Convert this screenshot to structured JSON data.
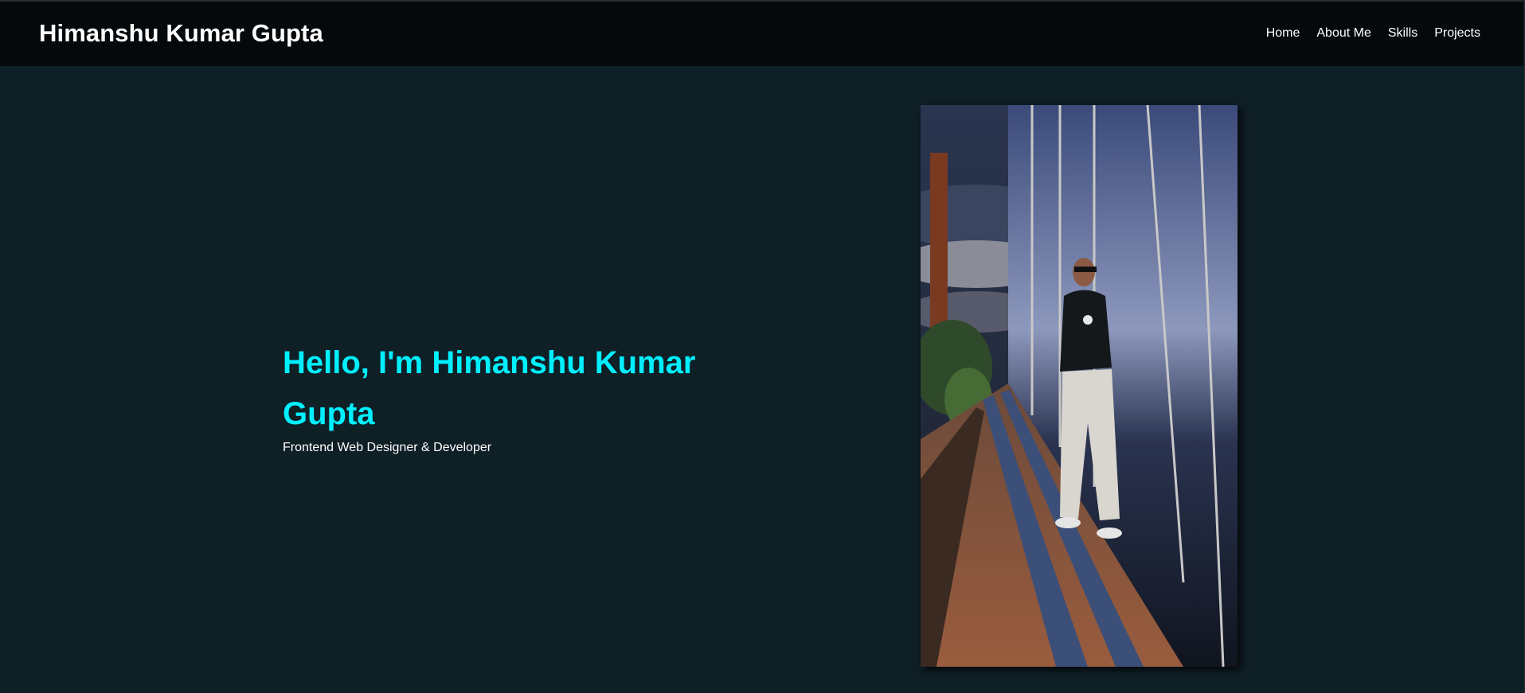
{
  "header": {
    "brand": "Himanshu Kumar Gupta",
    "nav": [
      {
        "label": "Home"
      },
      {
        "label": "About Me"
      },
      {
        "label": "Skills"
      },
      {
        "label": "Projects"
      }
    ]
  },
  "hero": {
    "heading": "Hello, I'm Himanshu Kumar Gupta",
    "subtitle": "Frontend Web Designer & Developer"
  },
  "colors": {
    "background": "#0f1f26",
    "navbar": "#05090c",
    "accent": "#00f0ff",
    "text": "#ffffff"
  }
}
